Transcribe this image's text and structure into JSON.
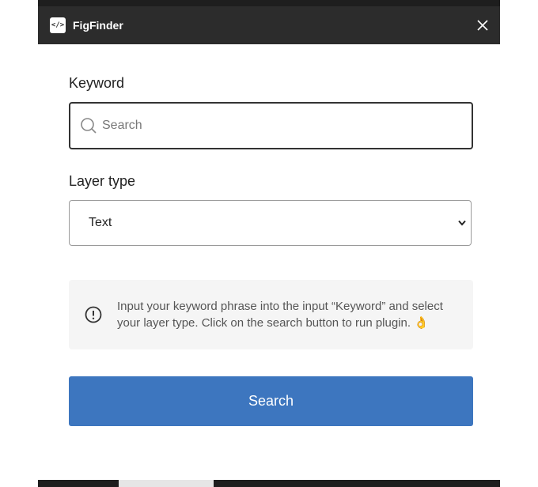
{
  "window": {
    "title": "FigFinder",
    "app_icon_glyph": "</>",
    "close_icon": "close-icon"
  },
  "form": {
    "keyword_label": "Keyword",
    "search_placeholder": "Search",
    "search_value": "",
    "layer_type_label": "Layer type",
    "layer_type_selected": "Text"
  },
  "info": {
    "icon": "info-circle-icon",
    "message": "Input your keyword phrase into the input “Keyword” and select your layer type. Click on the search button to run plugin. 👌"
  },
  "actions": {
    "search_label": "Search"
  },
  "colors": {
    "titlebar": "#2c2c2c",
    "primary_button": "#3d76bf",
    "info_background": "#f5f5f5"
  }
}
